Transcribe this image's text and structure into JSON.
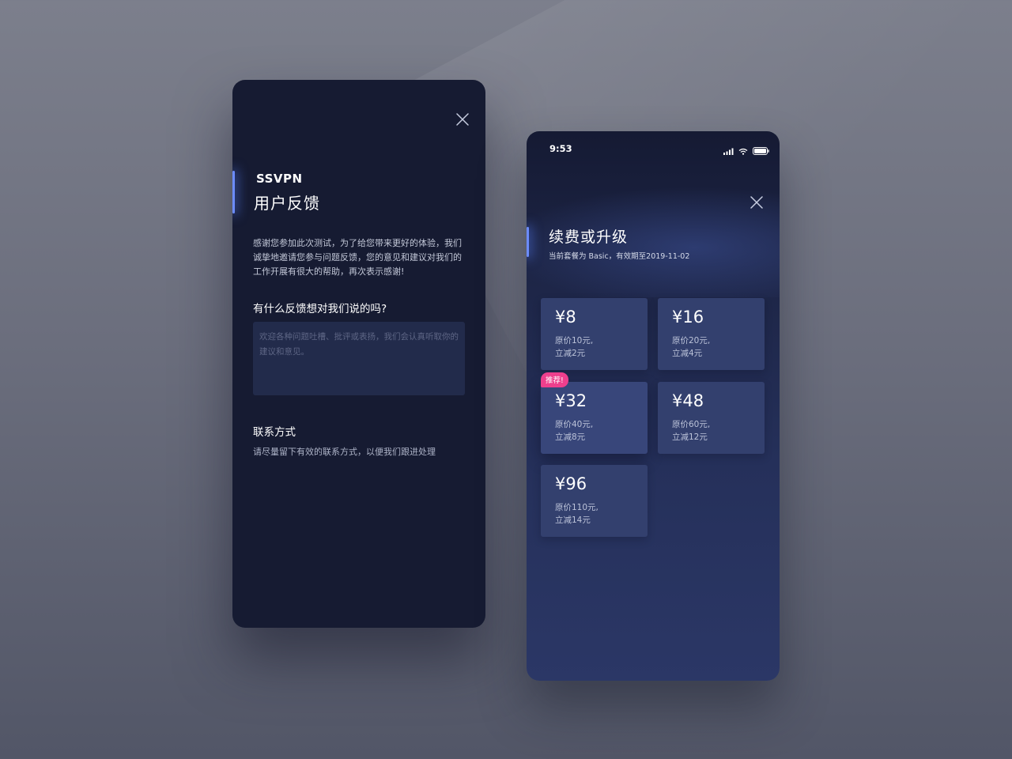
{
  "feedback": {
    "brand": "SSVPN",
    "title": "用户反馈",
    "intro": "感谢您参加此次测试，为了给您带来更好的体验，我们诚挚地邀请您参与问题反馈，您的意见和建议对我们的工作开展有很大的帮助，再次表示感谢!",
    "question_label": "有什么反馈想对我们说的吗?",
    "input_placeholder": "欢迎各种问题吐槽、批评或表扬，我们会认真听取你的建议和意见。",
    "contact_label": "联系方式",
    "contact_hint": "请尽量留下有效的联系方式，以便我们跟进处理",
    "close_icon": "close-icon"
  },
  "renew": {
    "status_time": "9:53",
    "status_icons": [
      "signal-icon",
      "wifi-icon",
      "battery-icon"
    ],
    "title": "续费或升级",
    "subtitle": "当前套餐为 Basic，有效期至2019-11-02",
    "close_icon": "close-icon",
    "badge": "推荐!",
    "plans": [
      {
        "price": "¥8",
        "original": "原价10元,",
        "discount": "立减2元"
      },
      {
        "price": "¥16",
        "original": "原价20元,",
        "discount": "立减4元"
      },
      {
        "price": "¥32",
        "original": "原价40元,",
        "discount": "立减8元"
      },
      {
        "price": "¥48",
        "original": "原价60元,",
        "discount": "立减12元"
      },
      {
        "price": "¥96",
        "original": "原价110元,",
        "discount": "立减14元"
      }
    ]
  },
  "colors": {
    "accent": "#6c8cff",
    "badge": "#ee3f8d",
    "feedback_bg": "#161b32",
    "plan_bg": "#33406e"
  }
}
